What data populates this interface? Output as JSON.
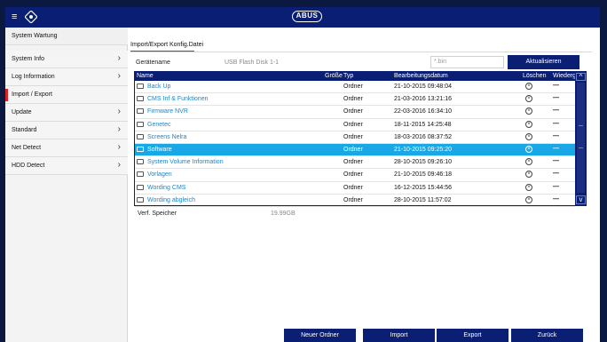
{
  "topbar": {
    "menu_icon": "menu-icon",
    "home_icon": "home-icon",
    "logo_text": "ABUS"
  },
  "sidebar": {
    "header": "System Wartung",
    "items": [
      {
        "label": "System Info",
        "chevron": true
      },
      {
        "label": "Log Information",
        "chevron": true
      },
      {
        "label": "Import / Export",
        "chevron": false,
        "active": true
      },
      {
        "label": "Update",
        "chevron": true
      },
      {
        "label": "Standard",
        "chevron": true
      },
      {
        "label": "Net Detect",
        "chevron": true
      },
      {
        "label": "HDD Detect",
        "chevron": true
      }
    ]
  },
  "main": {
    "title": "Import/Export Konfig.Datei",
    "device_label": "Gerätename",
    "device_value": "USB Flash Disk 1-1",
    "extension_placeholder": "*.bin",
    "refresh_label": "Aktualisieren",
    "columns": {
      "name": "Name",
      "size": "Größe",
      "type": "Typ",
      "date": "Bearbeitungsdatum",
      "delete": "Löschen",
      "replay": "Wiederg"
    },
    "rows": [
      {
        "name": "Back Up",
        "type": "Ordner",
        "date": "21-10-2015 09:48:04",
        "selected": false
      },
      {
        "name": "CMS Inf & Funktionen",
        "type": "Ordner",
        "date": "21-03-2016 13:21:16",
        "selected": false
      },
      {
        "name": "Firmware NVR",
        "type": "Ordner",
        "date": "22-03-2016 16:34:10",
        "selected": false
      },
      {
        "name": "Genetec",
        "type": "Ordner",
        "date": "18-11-2015 14:25:48",
        "selected": false
      },
      {
        "name": "Screens Nelra",
        "type": "Ordner",
        "date": "18-03-2016 08:37:52",
        "selected": false
      },
      {
        "name": "Software",
        "type": "Ordner",
        "date": "21-10-2015 09:25:20",
        "selected": true
      },
      {
        "name": "System Volume Information",
        "type": "Ordner",
        "date": "28-10-2015 09:26:10",
        "selected": false
      },
      {
        "name": "Vorlagen",
        "type": "Ordner",
        "date": "21-10-2015 09:46:18",
        "selected": false
      },
      {
        "name": "Wording CMS",
        "type": "Ordner",
        "date": "16-12-2015 15:44:56",
        "selected": false
      },
      {
        "name": "Wording abgleich",
        "type": "Ordner",
        "date": "28-10-2015 11:57:02",
        "selected": false
      }
    ],
    "delete_symbol": "⊗",
    "replay_symbol": "—",
    "free_space_label": "Verf. Speicher",
    "free_space_value": "19.99GB"
  },
  "buttons": {
    "new_folder": "Neuer Ordner",
    "import": "Import",
    "export": "Export",
    "back": "Zurück"
  },
  "colors": {
    "brand_navy": "#0a1f73",
    "selected_row": "#1aa7e6",
    "active_marker": "#e02020",
    "link_blue": "#1b86c9"
  }
}
